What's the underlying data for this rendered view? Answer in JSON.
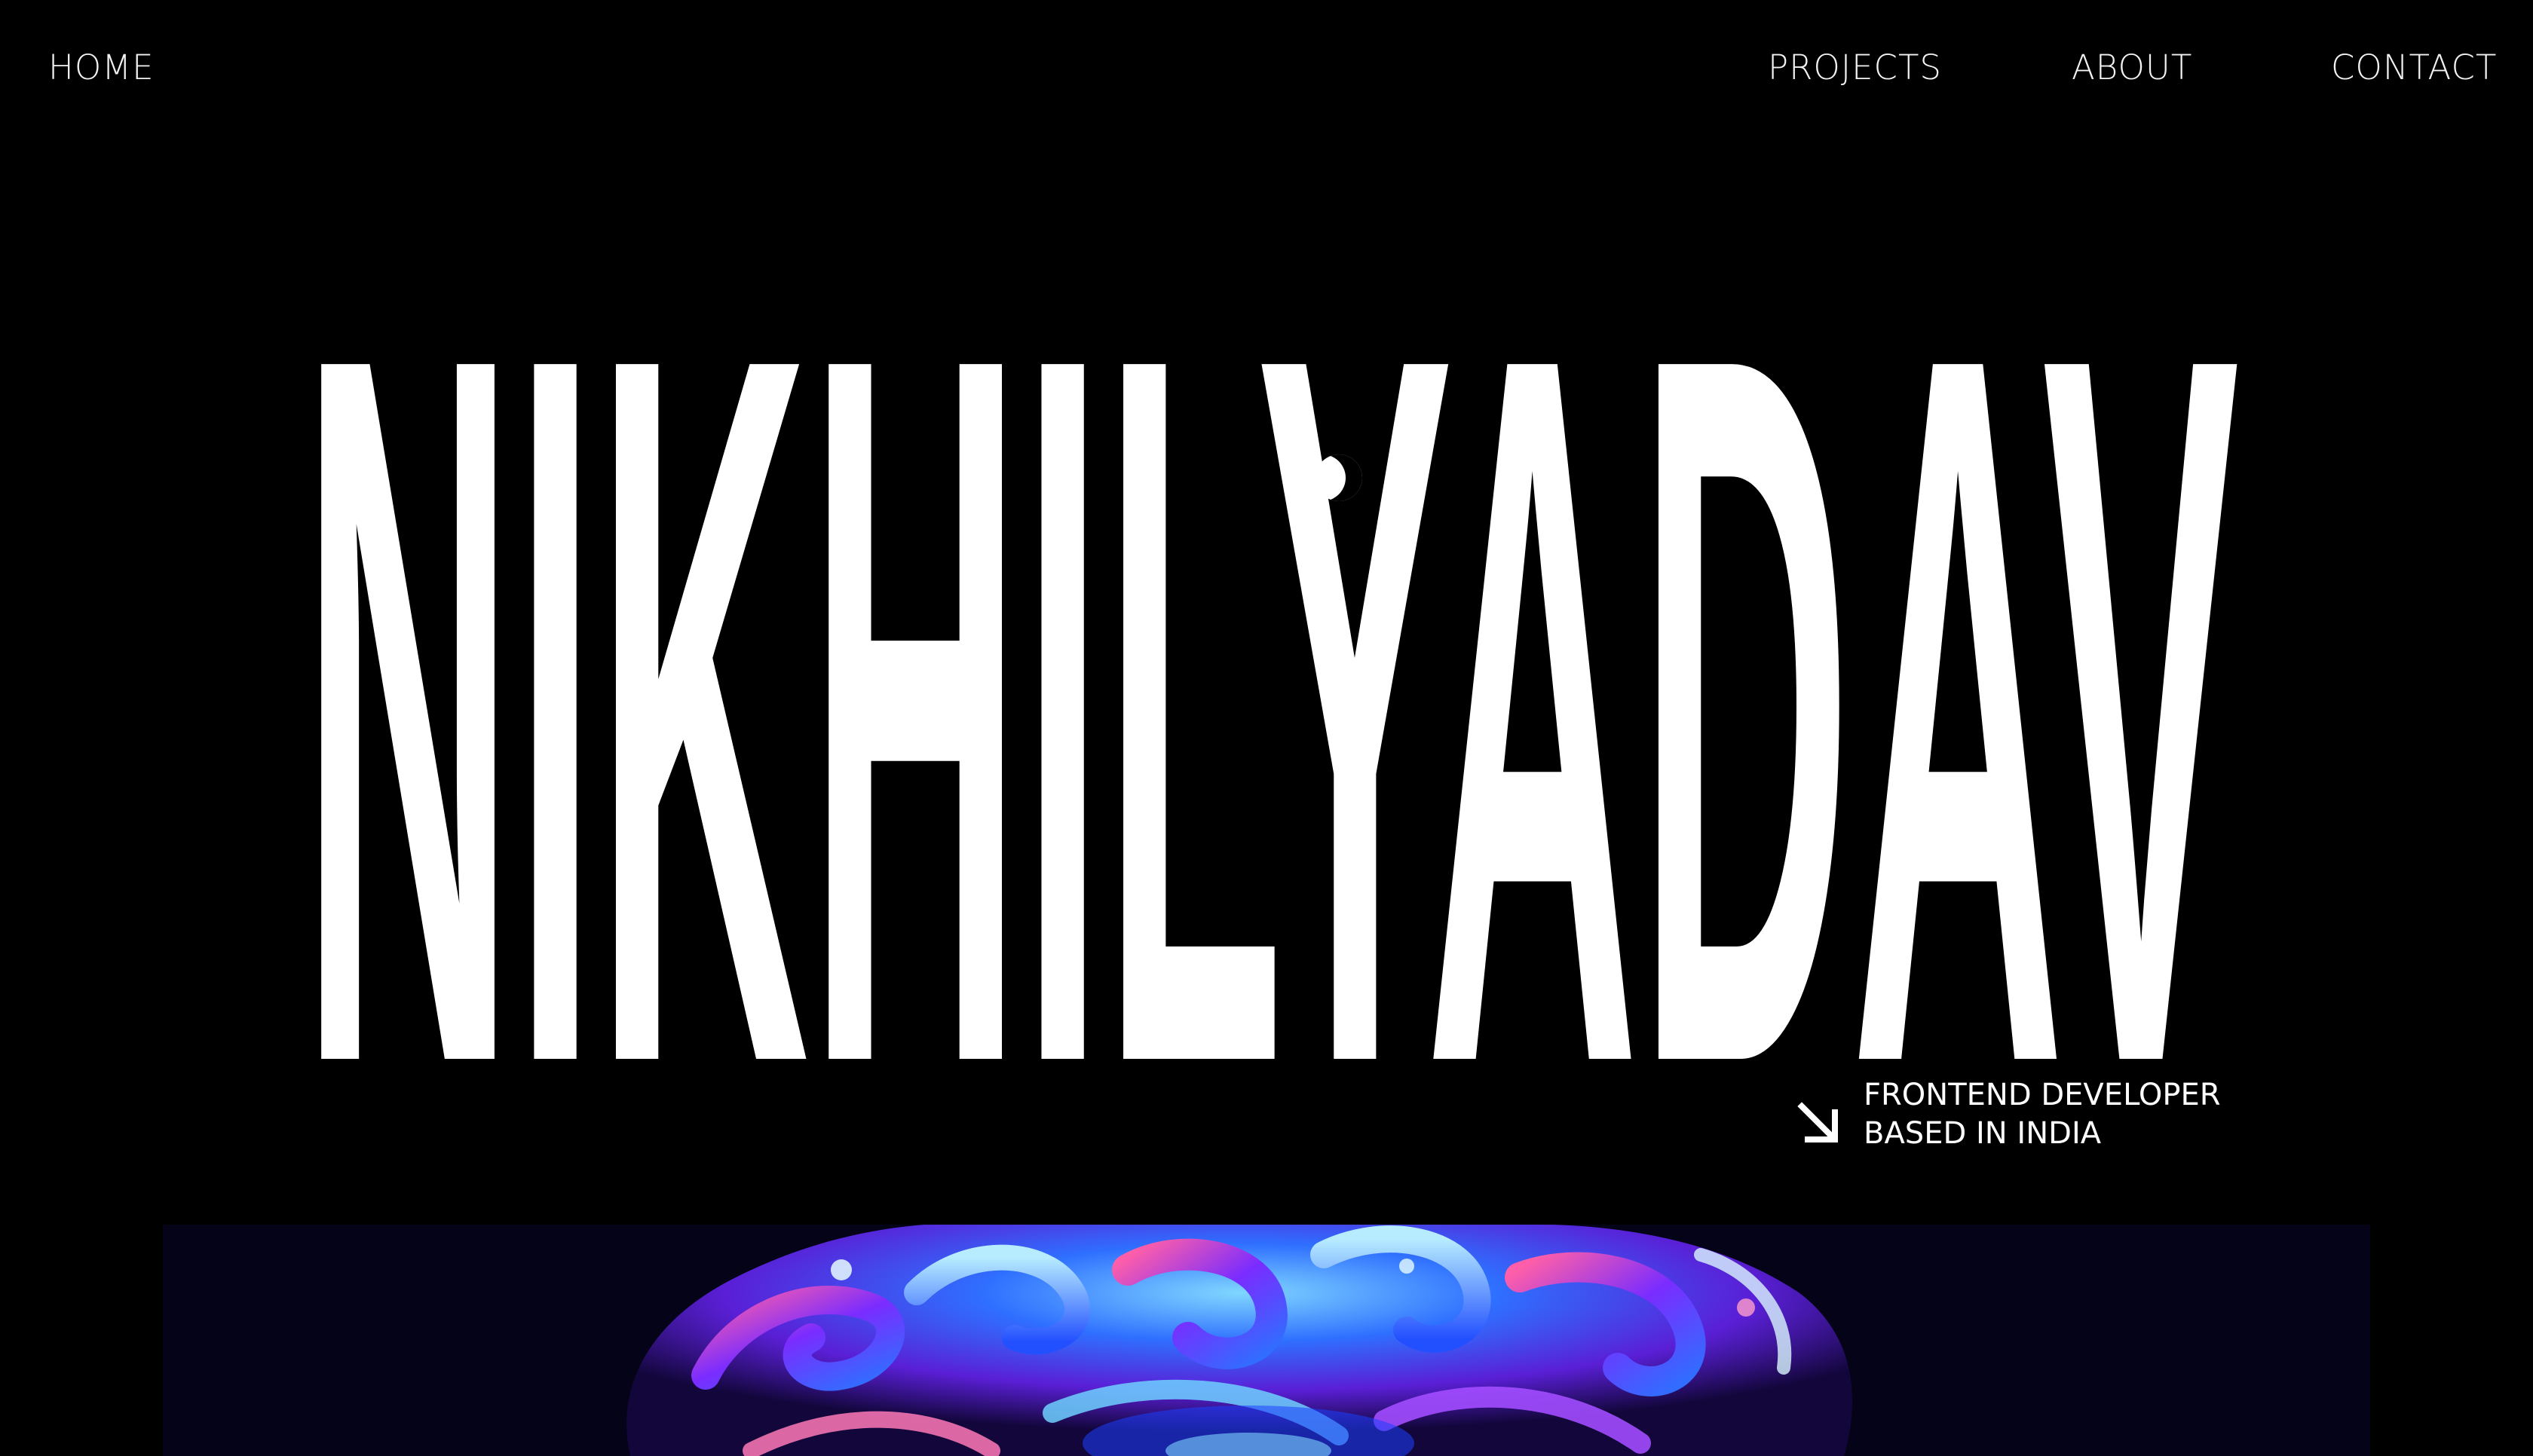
{
  "nav": {
    "home_label": "HOME",
    "projects_label": "PROJECTS",
    "about_label": "ABOUT",
    "contact_label": "CONTACT"
  },
  "hero": {
    "name": "NIKHILYADAV",
    "tagline_line1": "FRONTEND DEVELOPER",
    "tagline_line2": "BASED IN INDIA",
    "arrow_icon": "arrow-down-right-icon"
  },
  "colors": {
    "background": "#000000",
    "text": "#ffffff",
    "image_background": "#040318",
    "image_accent_blue": "#2f6fff",
    "image_accent_purple": "#7a2cff",
    "image_accent_pink": "#ff5fa8"
  }
}
